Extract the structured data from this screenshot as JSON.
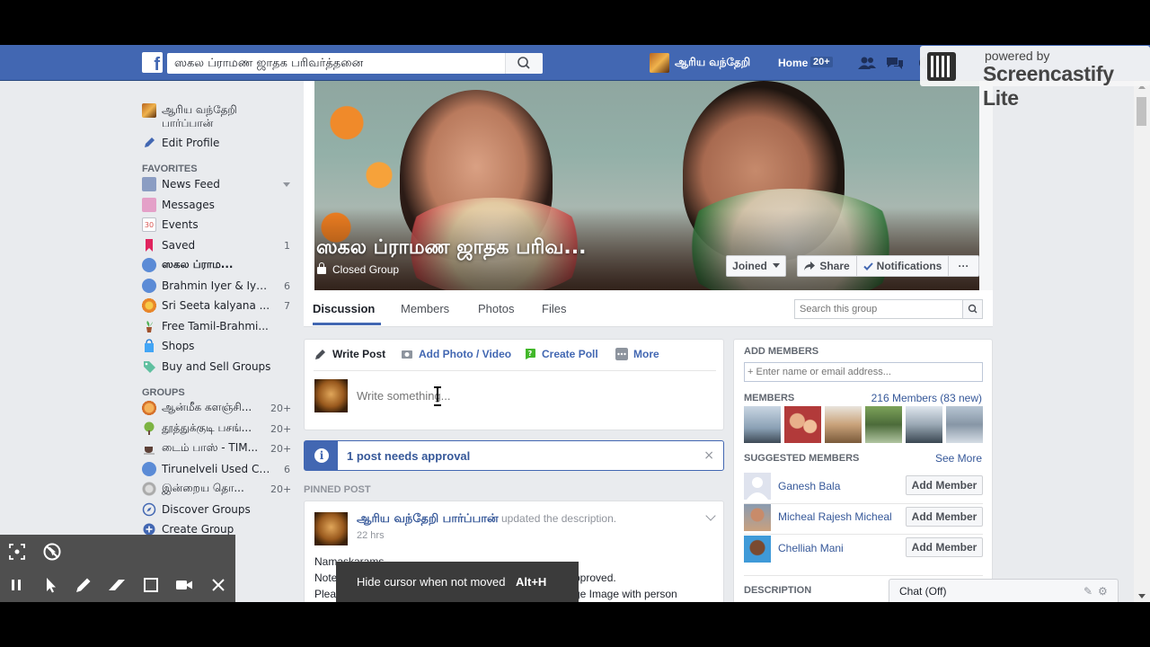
{
  "topbar": {
    "search_value": "ஸகல ப்ராமண ஜாதக பரிவர்த்தனை",
    "user_name": "ஆரிய வந்தேறி",
    "home_label": "Home",
    "home_count": "20+"
  },
  "screencastify": {
    "small": "powered by",
    "big": "Screencastify Lite"
  },
  "left_nav": {
    "profile_line1": "ஆரிய வந்தேறி",
    "profile_line2": "பார்ப்பான்",
    "edit_profile": "Edit Profile",
    "favorites_header": "FAVORITES",
    "favorites": [
      {
        "label": "News Feed",
        "count": ""
      },
      {
        "label": "Messages",
        "count": ""
      },
      {
        "label": "Events",
        "count": ""
      },
      {
        "label": "Saved",
        "count": "1"
      },
      {
        "label": "ஸகல ப்ராம...",
        "count": ""
      },
      {
        "label": "Brahmin Iyer & Iyen...",
        "count": "6"
      },
      {
        "label": "Sri Seeta kalyana ...",
        "count": "7"
      },
      {
        "label": "Free Tamil-Brahmi...",
        "count": ""
      },
      {
        "label": "Shops",
        "count": ""
      },
      {
        "label": "Buy and Sell Groups",
        "count": ""
      }
    ],
    "groups_header": "GROUPS",
    "groups": [
      {
        "label": "ஆன்மீக களஞ்சி...",
        "count": "20+"
      },
      {
        "label": "தூத்துக்குடி பசங்...",
        "count": "20+"
      },
      {
        "label": "டைம் பாஸ் - TIM...",
        "count": "20+"
      },
      {
        "label": "Tirunelveli Used Ca...",
        "count": "6"
      },
      {
        "label": "இன்றைய தொ...",
        "count": "20+"
      },
      {
        "label": "Discover Groups",
        "count": ""
      },
      {
        "label": "Create Group",
        "count": ""
      }
    ]
  },
  "group": {
    "title": "ஸகல ப்ராமண ஜாதக பரிவ...",
    "privacy": "Closed Group",
    "joined": "Joined",
    "share": "Share",
    "notifications": "Notifications",
    "more": "···",
    "tabs": [
      "Discussion",
      "Members",
      "Photos",
      "Files"
    ],
    "search_placeholder": "Search this group"
  },
  "composer": {
    "write_post": "Write Post",
    "add_photo": "Add Photo / Video",
    "create_poll": "Create Poll",
    "more": "More",
    "placeholder": "Write something..."
  },
  "approval": {
    "text": "1 post needs approval",
    "close": "×"
  },
  "pinned_label": "PINNED POST",
  "post": {
    "author": "ஆரிய வந்தேறி பார்ப்பான்",
    "action": " updated the description.",
    "time": "22 hrs",
    "line1": "Namaskarams",
    "line2": "Note",
    "line2_end": "pproved.",
    "line3": "Plea",
    "line3_end": "ge Image with person"
  },
  "right": {
    "add_members_header": "ADD MEMBERS",
    "add_placeholder": "+ Enter name or email address...",
    "members_header": "MEMBERS",
    "members_count": "216 Members (83 new)",
    "suggested_header": "SUGGESTED MEMBERS",
    "see_more": "See More",
    "suggested": [
      {
        "name": "Ganesh Bala",
        "button": "Add Member"
      },
      {
        "name": "Micheal Rajesh Micheal",
        "button": "Add Member"
      },
      {
        "name": "Chelliah Mani",
        "button": "Add Member"
      }
    ],
    "description_header": "DESCRIPTION"
  },
  "chat": {
    "label": "Chat (Off)"
  },
  "tooltip": {
    "text": "Hide cursor when not moved",
    "key": "Alt+H"
  }
}
